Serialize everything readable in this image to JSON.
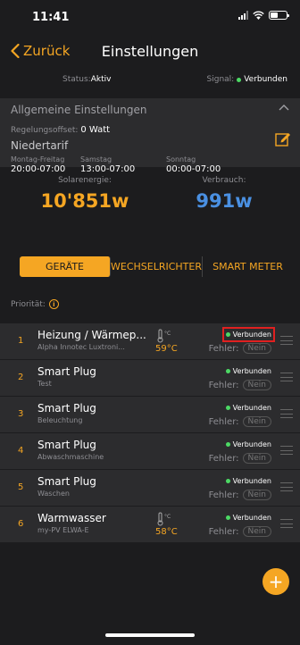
{
  "statusbar": {
    "time": "11:41"
  },
  "nav": {
    "back_label": "Zurück",
    "title": "Einstellungen"
  },
  "status": {
    "label": "Status:",
    "value": "Aktiv",
    "signal_label": "Signal:",
    "signal_value": "Verbunden"
  },
  "general": {
    "title": "Allgemeine Einstellungen",
    "offset_label": "Regelungsoffset:",
    "offset_value": "0 Watt",
    "tarif": "Niedertarif",
    "schedule": [
      {
        "day": "Montag-Freitag",
        "time": "20:00-07:00"
      },
      {
        "day": "Samstag",
        "time": "13:00-07:00"
      },
      {
        "day": "Sonntag",
        "time": "00:00-07:00"
      }
    ]
  },
  "energy": {
    "solar_label": "Solarenergie:",
    "solar_value": "10'851w",
    "verbrauch_label": "Verbrauch:",
    "verbrauch_value": "991w"
  },
  "tabs": [
    {
      "label": "GERÄTE",
      "active": true
    },
    {
      "label": "WECHSELRICHTER",
      "active": false
    },
    {
      "label": "SMART METER",
      "active": false
    }
  ],
  "priority_label": "Priorität:",
  "devices": [
    {
      "prio": "1",
      "name": "Heizung / Wärmep...",
      "sub": "Alpha Innotec Luxtroni...",
      "temp": "59°C",
      "status": "Verbunden",
      "error_label": "Fehler:",
      "error_value": "Nein"
    },
    {
      "prio": "2",
      "name": "Smart Plug",
      "sub": "Test",
      "temp": "",
      "status": "Verbunden",
      "error_label": "Fehler:",
      "error_value": "Nein"
    },
    {
      "prio": "3",
      "name": "Smart Plug",
      "sub": "Beleuchtung",
      "temp": "",
      "status": "Verbunden",
      "error_label": "Fehler:",
      "error_value": "Nein"
    },
    {
      "prio": "4",
      "name": "Smart Plug",
      "sub": "Abwaschmaschine",
      "temp": "",
      "status": "Verbunden",
      "error_label": "Fehler:",
      "error_value": "Nein"
    },
    {
      "prio": "5",
      "name": "Smart Plug",
      "sub": "Waschen",
      "temp": "",
      "status": "Verbunden",
      "error_label": "Fehler:",
      "error_value": "Nein"
    },
    {
      "prio": "6",
      "name": "Warmwasser",
      "sub": "my-PV ELWA-E",
      "temp": "58°C",
      "status": "Verbunden",
      "error_label": "Fehler:",
      "error_value": "Nein"
    }
  ],
  "fab_label": "+",
  "colors": {
    "accent": "#f5a623",
    "connected": "#4cd964",
    "consumption": "#4a90e2",
    "highlight": "#e02020"
  }
}
